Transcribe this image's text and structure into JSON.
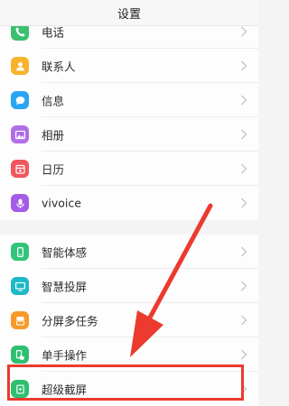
{
  "header": {
    "title": "设置"
  },
  "group1": {
    "items": [
      {
        "label": "电话",
        "icon": "phone-icon",
        "color": "#3cc06f"
      },
      {
        "label": "联系人",
        "icon": "contacts-icon",
        "color": "#f7b32b"
      },
      {
        "label": "信息",
        "icon": "message-icon",
        "color": "#2aa4f4"
      },
      {
        "label": "相册",
        "icon": "album-icon",
        "color": "#b06ee8"
      },
      {
        "label": "日历",
        "icon": "calendar-icon",
        "color": "#f0565c"
      },
      {
        "label": "vivoice",
        "icon": "mic-icon",
        "color": "#a45be6"
      }
    ]
  },
  "group2": {
    "items": [
      {
        "label": "智能体感",
        "icon": "motion-icon",
        "color": "#31c47a"
      },
      {
        "label": "智慧投屏",
        "icon": "screencast-icon",
        "color": "#1fb8c9"
      },
      {
        "label": "分屏多任务",
        "icon": "split-screen-icon",
        "color": "#f79a2a"
      },
      {
        "label": "单手操作",
        "icon": "one-hand-icon",
        "color": "#2fbf71"
      },
      {
        "label": "超级截屏",
        "icon": "screenshot-icon",
        "color": "#2fbf71"
      }
    ]
  },
  "annotation": {
    "color": "#ec3a2f"
  }
}
